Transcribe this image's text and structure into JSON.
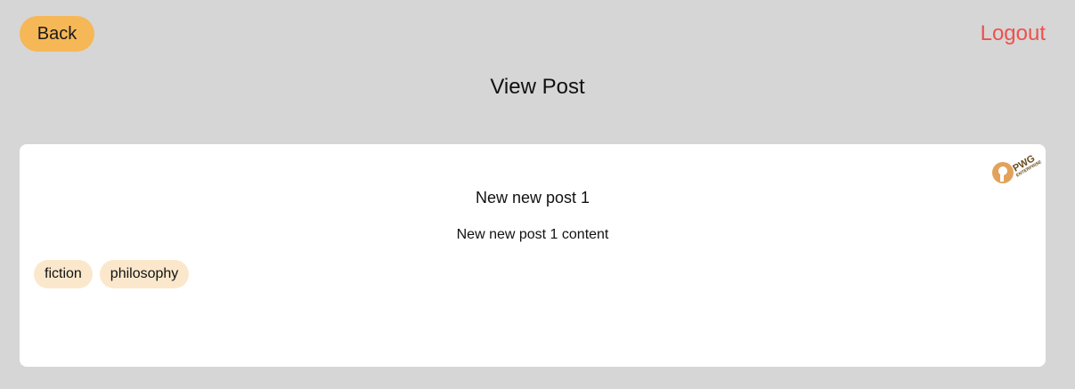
{
  "header": {
    "back_label": "Back",
    "logout_label": "Logout",
    "page_title": "View Post"
  },
  "post": {
    "title": "New new post 1",
    "content": "New new post 1 content",
    "tags": [
      "fiction",
      "philosophy"
    ]
  },
  "brand": {
    "logo_icon": "pwg-enterprise-logo",
    "logo_text": "PWG",
    "logo_subtext": "ENTERPRISE"
  },
  "colors": {
    "background": "#d6d6d6",
    "back_button": "#f6b756",
    "logout_text": "#f0504c",
    "card": "#ffffff",
    "tag_background": "#fbe8cc"
  }
}
